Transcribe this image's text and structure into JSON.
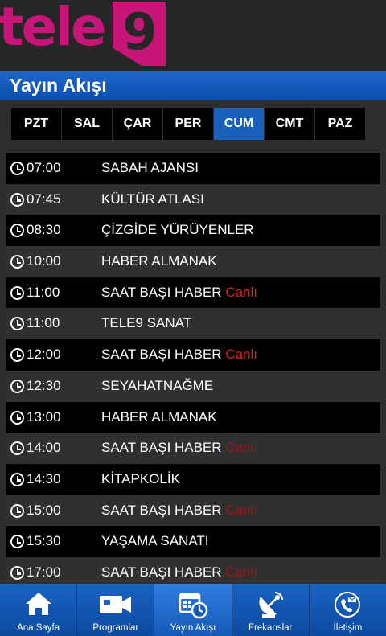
{
  "brand": {
    "logo_text": "tele",
    "logo_number": "9",
    "accent": "#c8157a"
  },
  "page": {
    "title": "Yayın Akışı"
  },
  "days": [
    {
      "label": "PZT",
      "active": false
    },
    {
      "label": "SAL",
      "active": false
    },
    {
      "label": "ÇAR",
      "active": false
    },
    {
      "label": "PER",
      "active": false
    },
    {
      "label": "CUM",
      "active": true
    },
    {
      "label": "CMT",
      "active": false
    },
    {
      "label": "PAZ",
      "active": false
    }
  ],
  "schedule": [
    {
      "time": "07:00",
      "program": "SABAH AJANSI",
      "live": ""
    },
    {
      "time": "07:45",
      "program": "KÜLTÜR ATLASI",
      "live": ""
    },
    {
      "time": "08:30",
      "program": "ÇİZGİDE YÜRÜYENLER",
      "live": ""
    },
    {
      "time": "10:00",
      "program": "HABER ALMANAK",
      "live": ""
    },
    {
      "time": "11:00",
      "program": "SAAT BAŞI HABER",
      "live": "Canlı"
    },
    {
      "time": "11:00",
      "program": "TELE9 SANAT",
      "live": ""
    },
    {
      "time": "12:00",
      "program": "SAAT BAŞI HABER",
      "live": "Canlı"
    },
    {
      "time": "12:30",
      "program": "SEYAHATNAĞME",
      "live": ""
    },
    {
      "time": "13:00",
      "program": "HABER ALMANAK",
      "live": ""
    },
    {
      "time": "14:00",
      "program": "SAAT BAŞI HABER",
      "live": "Canlı"
    },
    {
      "time": "14:30",
      "program": "KİTAPKOLİK",
      "live": ""
    },
    {
      "time": "15:00",
      "program": "SAAT BAŞI HABER",
      "live": "Canlı"
    },
    {
      "time": "15:30",
      "program": "YAŞAMA SANATI",
      "live": ""
    },
    {
      "time": "17:00",
      "program": "SAAT BAŞI HABER",
      "live": "Canlı"
    }
  ],
  "tabs": [
    {
      "label": "Ana Sayfa",
      "icon": "home-icon",
      "active": false
    },
    {
      "label": "Programlar",
      "icon": "video-camera-icon",
      "active": false
    },
    {
      "label": "Yayın Akışı",
      "icon": "calendar-clock-icon",
      "active": true
    },
    {
      "label": "Frekanslar",
      "icon": "satellite-dish-icon",
      "active": false
    },
    {
      "label": "İletişim",
      "icon": "contact-phone-icon",
      "active": false
    }
  ],
  "colors": {
    "header_blue": "#0a4fb0",
    "live_red": "#e02020",
    "row_dark": "#000000",
    "row_gray": "#303030"
  }
}
